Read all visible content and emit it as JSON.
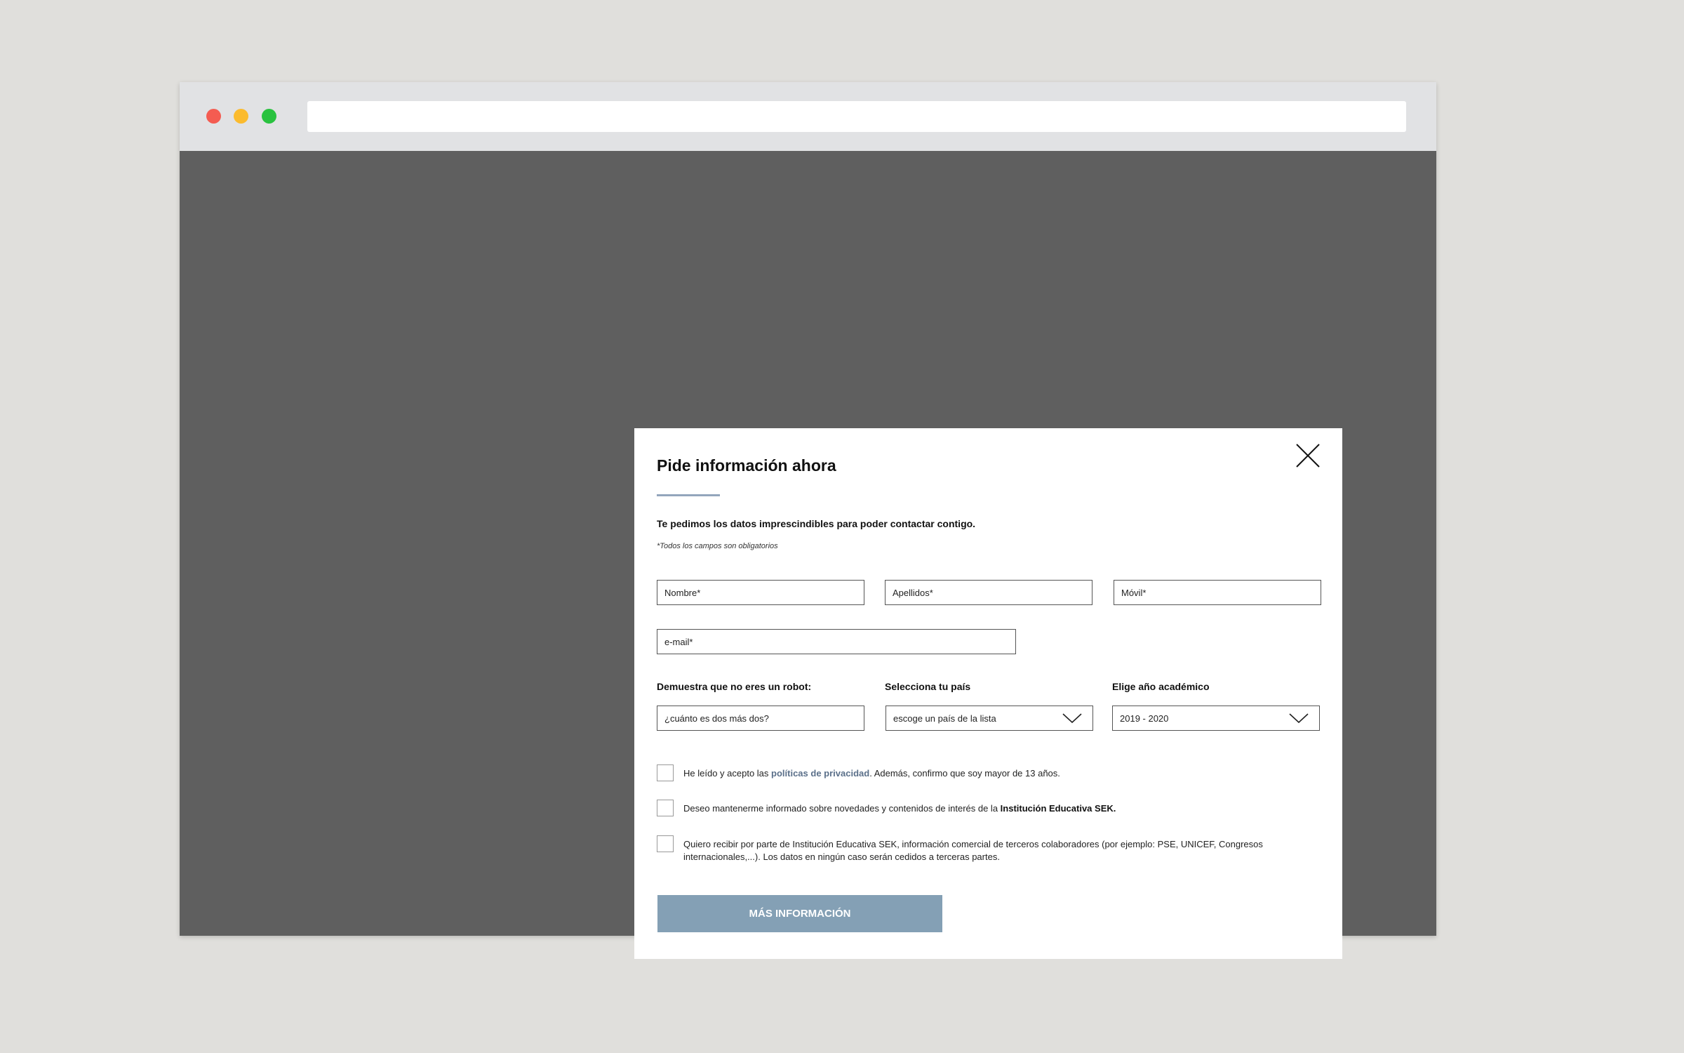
{
  "modal": {
    "title": "Pide información ahora",
    "intro": "Te pedimos los datos imprescindibles para poder contactar contigo.",
    "required_note": "*Todos los campos son obligatorios",
    "fields": {
      "nombre_placeholder": "Nombre*",
      "apellidos_placeholder": "Apellidos*",
      "movil_placeholder": "Móvil*",
      "email_placeholder": "e-mail*"
    },
    "robot": {
      "label": "Demuestra que no eres un robot:",
      "placeholder": "¿cuánto es dos más dos?"
    },
    "country": {
      "label": "Selecciona tu país",
      "value": "escoge un país de la lista"
    },
    "year": {
      "label": "Elige año académico",
      "value": "2019 - 2020"
    },
    "checks": {
      "privacy_prefix": "He leído y acepto las ",
      "privacy_link": "políticas de privacidad",
      "privacy_suffix": ". Además, confirmo que soy mayor de 13 años.",
      "newsletter_prefix": "Deseo mantenerme informado sobre novedades y contenidos de interés de la ",
      "newsletter_bold": "Institución Educativa SEK.",
      "third_party": "Quiero recibir por parte de Institución Educativa SEK, información comercial de terceros colaboradores (por ejemplo: PSE, UNICEF, Congresos internacionales,...). Los datos en ningún caso serán cedidos a terceras partes."
    },
    "submit_label": "MÁS INFORMACIÓN"
  },
  "colors": {
    "page_bg": "#e0dfdc",
    "overlay": "#5f5f5f",
    "accent_rule": "#93a6bc",
    "link": "#5b708a",
    "submit_bg": "#84a0b5",
    "dot_red": "#f45c51",
    "dot_yellow": "#fbbb2e",
    "dot_green": "#29c23f"
  },
  "icons": {
    "close": "close-icon",
    "select_arrow": "chevron-down-icon"
  }
}
